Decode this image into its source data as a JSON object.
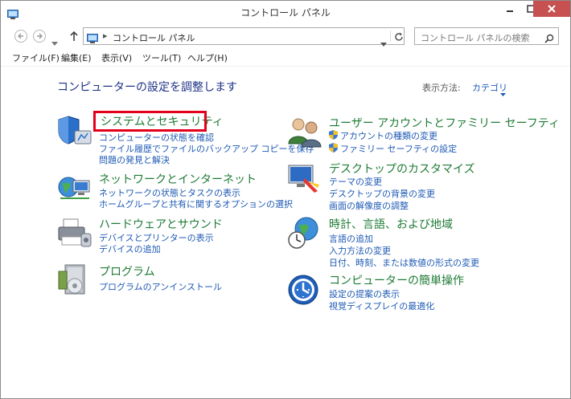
{
  "window": {
    "title": "コントロール パネル"
  },
  "address": {
    "path": "コントロール パネル"
  },
  "search": {
    "placeholder": "コントロール パネルの検索"
  },
  "menu": [
    "ファイル(F)",
    "編集(E)",
    "表示(V)",
    "ツール(T)",
    "ヘルプ(H)"
  ],
  "main": {
    "heading": "コンピューターの設定を調整します",
    "view_by_label": "表示方法:",
    "view_by_value": "カテゴリ"
  },
  "categories_left": [
    {
      "title": "システムとセキュリティ",
      "icon": "shield-icon",
      "links": [
        "コンピューターの状態を確認",
        "ファイル履歴でファイルのバックアップ コピーを保存",
        "問題の発見と解決"
      ]
    },
    {
      "title": "ネットワークとインターネット",
      "icon": "network-globe-icon",
      "links": [
        "ネットワークの状態とタスクの表示",
        "ホームグループと共有に関するオプションの選択"
      ]
    },
    {
      "title": "ハードウェアとサウンド",
      "icon": "printer-icon",
      "links": [
        "デバイスとプリンターの表示",
        "デバイスの追加"
      ]
    },
    {
      "title": "プログラム",
      "icon": "programs-icon",
      "links": [
        "プログラムのアンインストール"
      ]
    }
  ],
  "categories_right": [
    {
      "title": "ユーザー アカウントとファミリー セーフティ",
      "icon": "users-icon",
      "links": [
        "アカウントの種類の変更",
        "ファミリー セーフティの設定"
      ]
    },
    {
      "title": "デスクトップのカスタマイズ",
      "icon": "display-paint-icon",
      "links": [
        "テーマの変更",
        "デスクトップの背景の変更",
        "画面の解像度の調整"
      ]
    },
    {
      "title": "時計、言語、および地域",
      "icon": "clock-globe-icon",
      "links": [
        "言語の追加",
        "入力方法の変更",
        "日付、時刻、または数値の形式の変更"
      ]
    },
    {
      "title": "コンピューターの簡単操作",
      "icon": "ease-of-access-icon",
      "links": [
        "設定の提案の表示",
        "視覚ディスプレイの最適化"
      ]
    }
  ]
}
